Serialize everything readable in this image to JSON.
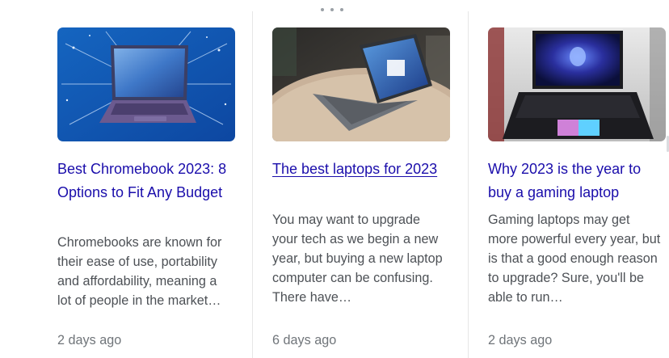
{
  "cards": [
    {
      "image_alt": "chromebook-image",
      "title": "Best Chromebook 2023: 8 Options to Fit Any Budget",
      "snippet": "Chromebooks are known for their ease of use, portability and affordability, meaning a lot of people in the market…",
      "age": "2 days ago"
    },
    {
      "image_alt": "laptop-on-table-image",
      "title": "The best laptops for 2023",
      "snippet": "You may want to upgrade your tech as we begin a new year, but buying a new laptop computer can be confusing. There have…",
      "age": "6 days ago"
    },
    {
      "image_alt": "gaming-laptop-image",
      "title": "Why 2023 is the year to buy a gaming laptop",
      "snippet": "Gaming laptops may get more powerful every year, but is that a good enough reason to upgrade? Sure, you'll be able to run…",
      "age": "2 days ago"
    }
  ],
  "colors": {
    "link": "#1a0dab",
    "snippet": "#4d5156",
    "age": "#70757a"
  }
}
